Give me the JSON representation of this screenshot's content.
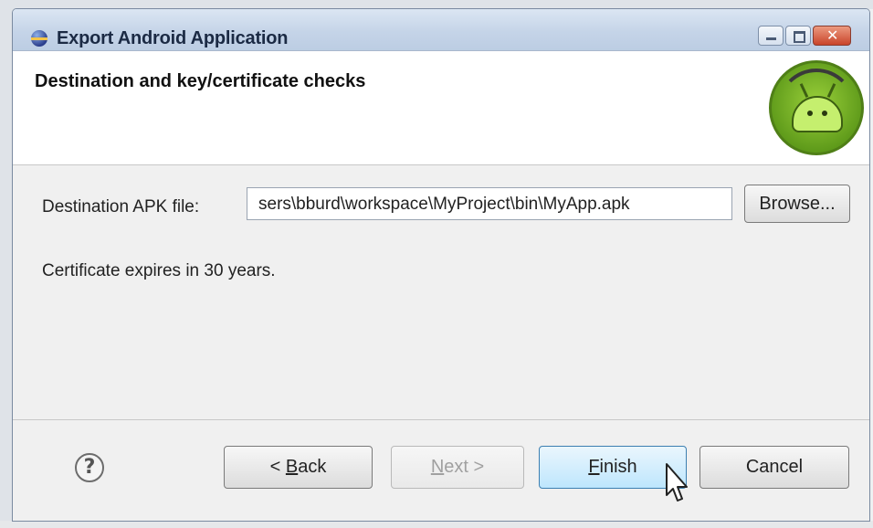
{
  "window": {
    "title": "Export Android Application"
  },
  "header": {
    "title": "Destination and key/certificate checks"
  },
  "form": {
    "destination_label": "Destination APK file:",
    "destination_value": "sers\\bburd\\workspace\\MyProject\\bin\\MyApp.apk",
    "browse_label": "Browse...",
    "certificate_message": "Certificate expires in 30 years."
  },
  "footer": {
    "help_label": "?",
    "back_prefix": "< ",
    "back_mnemonic": "B",
    "back_rest": "ack",
    "next_mnemonic": "N",
    "next_rest": "ext >",
    "finish_mnemonic": "F",
    "finish_rest": "inish",
    "cancel_label": "Cancel"
  },
  "icons": {
    "app": "eclipse-icon",
    "wizard": "android-logo",
    "help": "help-icon",
    "cursor": "mouse-pointer"
  }
}
